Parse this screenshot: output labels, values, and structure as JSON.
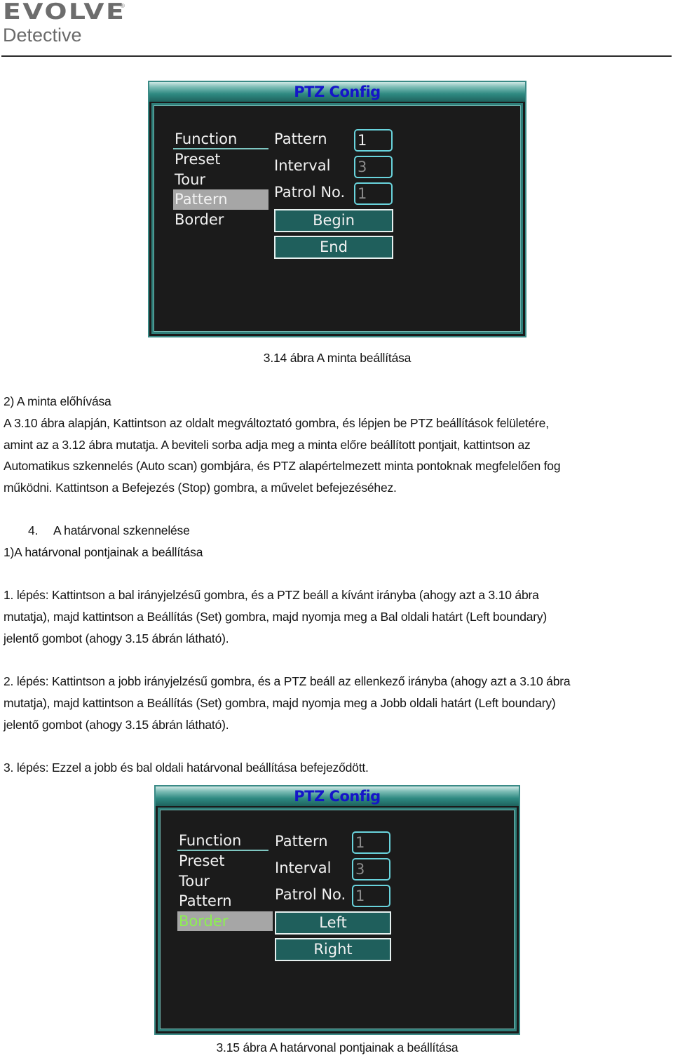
{
  "header": {
    "brand": "EVOLVE",
    "registered_mark": "®",
    "product": "Detective"
  },
  "figure1": {
    "dialog_title": "PTZ Config",
    "menu": [
      {
        "label": "Function",
        "kind": "header"
      },
      {
        "label": "Preset"
      },
      {
        "label": "Tour"
      },
      {
        "label": "Pattern",
        "selected": true
      },
      {
        "label": "Border"
      }
    ],
    "fields": [
      {
        "label": "Pattern",
        "value": "1"
      },
      {
        "label": "Interval",
        "value": "3"
      },
      {
        "label": "Patrol No.",
        "value": "1"
      }
    ],
    "buttons": [
      {
        "label": "Begin"
      },
      {
        "label": "End"
      }
    ],
    "caption": "3.14 ábra A minta beállítása"
  },
  "section_recall": {
    "heading": "2) A minta előhívása",
    "lines": [
      "A 3.10 ábra alapján, Kattintson az oldalt megváltoztató gombra, és lépjen be PTZ beállítások felületére,",
      "amint az a 3.12 ábra mutatja. A beviteli sorba adja meg a minta előre beállított pontjait, kattintson az",
      "Automatikus szkennelés (Auto scan) gombjára, és PTZ alapértelmezett minta pontoknak megfelelően fog",
      "működni. Kattintson a Befejezés (Stop) gombra, a művelet befejezéséhez."
    ]
  },
  "section_border": {
    "heading_number": "4.",
    "heading": "A határvonal szkennelése",
    "subheading": "1)A határvonal pontjainak a beállítása",
    "step1_lines": [
      "1. lépés: Kattintson a bal irányjelzésű gombra, és a PTZ beáll a kívánt irányba (ahogy azt a 3.10 ábra",
      "mutatja), majd kattintson a Beállítás (Set) gombra, majd nyomja meg a Bal oldali határt (Left boundary)",
      "jelentő gombot (ahogy 3.15 ábrán látható)."
    ],
    "step2_lines": [
      "2. lépés: Kattintson a jobb irányjelzésű gombra, és a PTZ beáll az ellenkező irányba (ahogy azt a 3.10 ábra",
      "mutatja), majd kattintson a Beállítás (Set) gombra, majd nyomja meg a Jobb oldali határt (Left boundary)",
      "jelentő gombot (ahogy 3.15 ábrán látható)."
    ],
    "step3": "3. lépés: Ezzel a jobb és bal oldali határvonal beállítása befejeződött."
  },
  "figure2": {
    "dialog_title": "PTZ Config",
    "menu": [
      {
        "label": "Function",
        "kind": "header"
      },
      {
        "label": "Preset"
      },
      {
        "label": "Tour"
      },
      {
        "label": "Pattern"
      },
      {
        "label": "Border",
        "selected": true
      }
    ],
    "fields": [
      {
        "label": "Pattern",
        "value": "1"
      },
      {
        "label": "Interval",
        "value": "3"
      },
      {
        "label": "Patrol No.",
        "value": "1"
      }
    ],
    "buttons": [
      {
        "label": "Left"
      },
      {
        "label": "Right"
      }
    ],
    "caption": "3.15 ábra A határvonal pontjainak a beállítása"
  },
  "colors": {
    "dialog_title": "#1515c8",
    "dialog_bg": "#1b1b1b",
    "teal_border": "#2f7f7a",
    "button_bg": "#1f5f5c",
    "input_border": "#69d3dc",
    "selected_bg": "#a6a6a6",
    "selected_border_text": "#8cf24f"
  }
}
